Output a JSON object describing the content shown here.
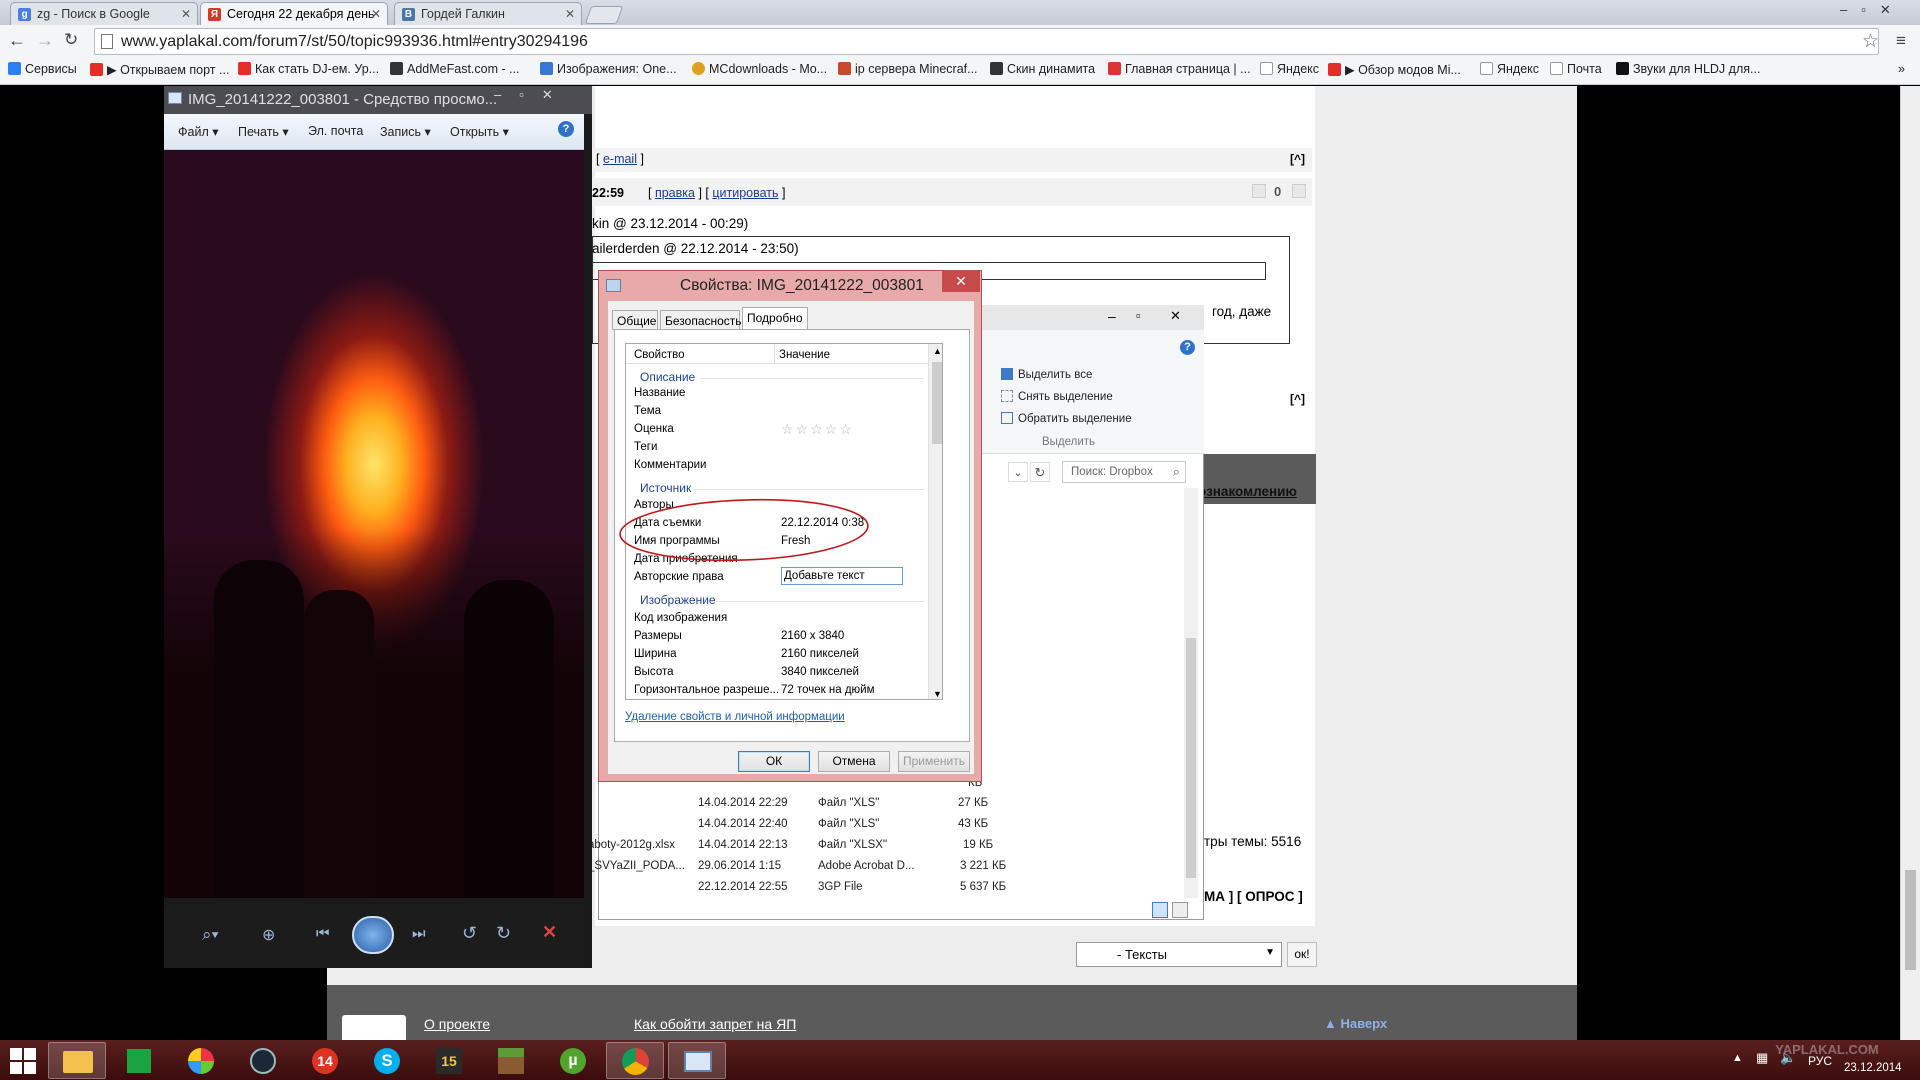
{
  "tabs": [
    {
      "label": "zg - Поиск в Google",
      "fav": "g",
      "color": "#4b7ee6"
    },
    {
      "label": "Сегодня 22 декабря день",
      "fav": "Я",
      "color": "#d43a2a"
    },
    {
      "label": "Гордей Галкин",
      "fav": "B",
      "color": "#4a76a8"
    }
  ],
  "url": "www.yaplakal.com/forum7/st/50/topic993936.html#entry30294196",
  "bookmarks": [
    {
      "label": "Сервисы",
      "color": "#2d7ff9"
    },
    {
      "label": "▶ Открываем порт ...",
      "color": "#e52d27"
    },
    {
      "label": "Как стать DJ-ем. Ур...",
      "color": "#e52d27"
    },
    {
      "label": "AddMeFast.com - ...",
      "color": "#333"
    },
    {
      "label": "Изображения: One...",
      "color": "#3777d8"
    },
    {
      "label": "MCdownloads - Mo...",
      "color": "#e0a020"
    },
    {
      "label": "ip сервера Minecraf...",
      "color": "#c84a2a"
    },
    {
      "label": "Скин динамита",
      "color": "#333"
    },
    {
      "label": "Главная страница | ...",
      "color": "#d33"
    },
    {
      "label": "Яндекс",
      "color": "#ddd"
    },
    {
      "label": "▶ Обзор модов Mi...",
      "color": "#e52d27"
    },
    {
      "label": "Яндекс",
      "color": "#ddd"
    },
    {
      "label": "Почта",
      "color": "#ddd"
    },
    {
      "label": "Звуки для HLDJ для...",
      "color": "#111"
    }
  ],
  "forum": {
    "email": "e-mail",
    "time": "22:59",
    "edit": "правка",
    "quote": "цитировать",
    "rating": "0",
    "quote1": "kin @ 23.12.2014 - 00:29)",
    "quote2": "ailerderden @ 22.12.2014 - 23:50)",
    "text_tail": "год, даже",
    "link_tail": "ознакомлению",
    "stats": "тры темы: 5516",
    "footer_buttons": "МА ] [ ОПРОС ]",
    "select": "- Тексты",
    "ok": "ок!",
    "about": "О проекте",
    "bypass": "Как обойти запрет на ЯП",
    "top": "Наверх"
  },
  "viewer": {
    "title": "IMG_20141222_003801 - Средство просмо...",
    "menu": [
      "Файл",
      "Печать",
      "Эл. почта",
      "Запись",
      "Открыть"
    ]
  },
  "dialog": {
    "title": "Свойства: IMG_20141222_003801",
    "tabs": [
      "Общие",
      "Безопасность",
      "Подробно"
    ],
    "col_prop": "Свойство",
    "col_val": "Значение",
    "groups": {
      "desc": "Описание",
      "source": "Источник",
      "image": "Изображение"
    },
    "rows": {
      "name": "Название",
      "subject": "Тема",
      "rating": "Оценка",
      "tags": "Теги",
      "comments": "Комментарии",
      "authors": "Авторы",
      "date_taken": "Дата съемки",
      "program": "Имя программы",
      "date_acq": "Дата приобретения",
      "copyright": "Авторские права",
      "image_id": "Код изображения",
      "dims": "Размеры",
      "width": "Ширина",
      "height": "Высота",
      "hres": "Горизонтальное разреше..."
    },
    "values": {
      "date_taken": "22.12.2014 0:38",
      "program": "Fresh",
      "copyright": "Добавьте текст",
      "dims": "2160 x 3840",
      "width": "2160 пикселей",
      "height": "3840 пикселей",
      "hres": "72 точек на дюйм"
    },
    "remove_link": "Удаление свойств и личной информации",
    "ok": "ОК",
    "cancel": "Отмена",
    "apply": "Применить"
  },
  "explorer": {
    "select_all": "Выделить все",
    "unselect": "Снять выделение",
    "invert": "Обратить выделение",
    "group": "Выделить",
    "search": "Поиск: Dropbox",
    "files": [
      {
        "name": "",
        "date": "",
        "type": "",
        "size": "КБ"
      },
      {
        "name": "",
        "date": "",
        "type": "",
        "size": "КБ"
      },
      {
        "name": "",
        "date": "",
        "type": "",
        "size": "КБ"
      },
      {
        "name": "",
        "date": "14.04.2014 22:29",
        "type": "Файл \"XLS\"",
        "size": "27 КБ"
      },
      {
        "name": "",
        "date": "14.04.2014 22:40",
        "type": "Файл \"XLS\"",
        "size": "43 КБ"
      },
      {
        "name": "aboty-2012g.xlsx",
        "date": "14.04.2014 22:13",
        "type": "Файл \"XLSX\"",
        "size": "19 КБ"
      },
      {
        "name": "_SVYaZII_PODA...",
        "date": "29.06.2014 1:15",
        "type": "Adobe Acrobat D...",
        "size": "3 221 КБ"
      },
      {
        "name": "",
        "date": "22.12.2014 22:55",
        "type": "3GP File",
        "size": "5 637 КБ"
      }
    ]
  },
  "taskbar": {
    "lang": "РУС",
    "date": "23.12.2014",
    "watermark": "YAPLAKAL.COM",
    "apps": [
      "file-explorer",
      "store",
      "windows-live",
      "steam",
      "app-14",
      "skype",
      "app-15",
      "minecraft",
      "utorrent",
      "chrome",
      "photo-viewer"
    ]
  }
}
